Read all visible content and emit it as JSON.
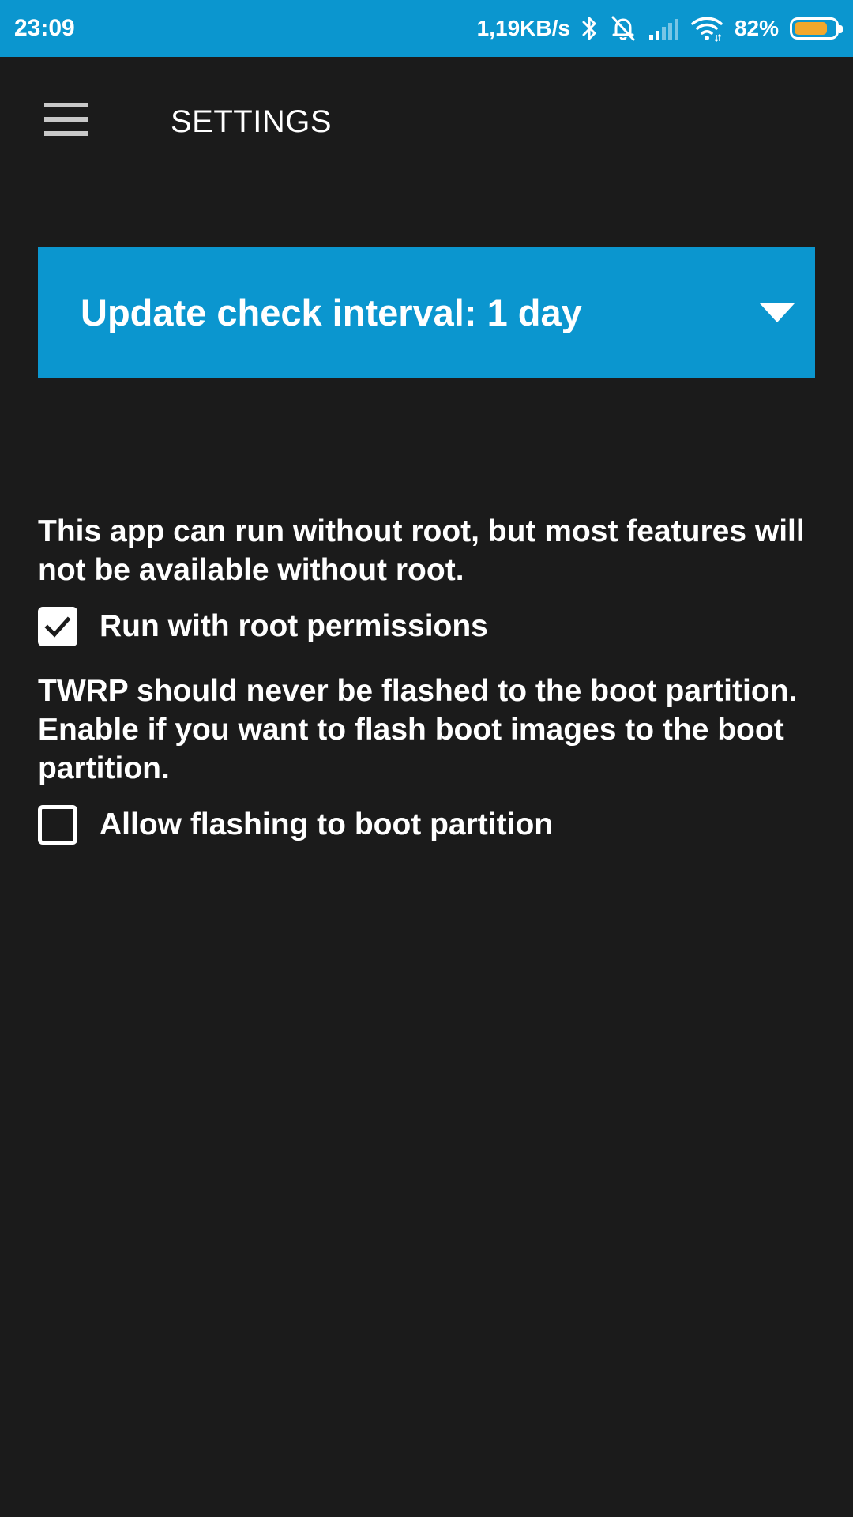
{
  "status_bar": {
    "time": "23:09",
    "network_speed": "1,19KB/s",
    "battery_percent": "82%",
    "battery_level": 0.82,
    "icons": [
      "bluetooth-icon",
      "alarm-off-icon",
      "signal-icon",
      "wifi-icon",
      "battery-icon"
    ],
    "background_color": "#0b96cf",
    "battery_fill_color": "#f2a82c"
  },
  "app_bar": {
    "menu_icon": "hamburger-menu-icon",
    "title": "SETTINGS"
  },
  "update_interval": {
    "label": "Update check interval: 1 day",
    "icon": "dropdown-arrow-icon",
    "background_color": "#0b96cf"
  },
  "root_section": {
    "description": "This app can run without root, but most features will not be available without root.",
    "checkbox_label": "Run with root permissions",
    "checked": true
  },
  "boot_section": {
    "description": "TWRP should never be flashed to the boot partition. Enable if you want to flash boot images to the boot partition.",
    "checkbox_label": "Allow flashing to boot partition",
    "checked": false
  },
  "theme": {
    "background_color": "#1b1b1b",
    "text_color": "#ffffff"
  }
}
